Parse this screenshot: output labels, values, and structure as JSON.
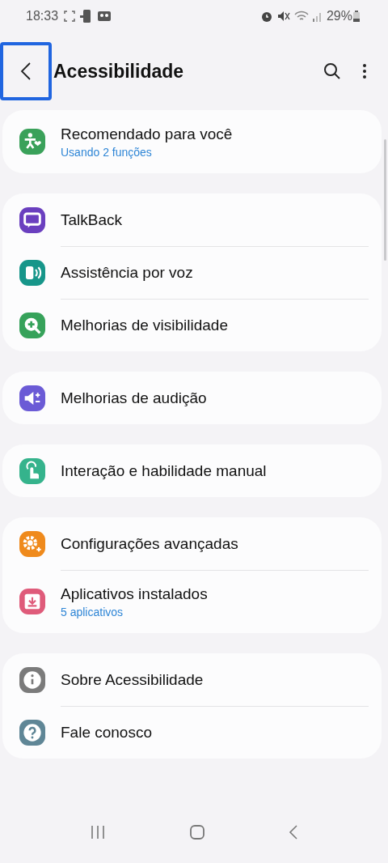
{
  "status_bar": {
    "time": "18:33",
    "battery": "29%"
  },
  "header": {
    "title": "Acessibilidade",
    "back_focused": true
  },
  "groups": [
    {
      "items": [
        {
          "title": "Recomendado para você",
          "subtitle": "Usando 2 funções",
          "color": "#3aa15a"
        }
      ]
    },
    {
      "items": [
        {
          "title": "TalkBack",
          "color": "#6a3fbf"
        },
        {
          "title": "Assistência por voz",
          "color": "#17968a"
        },
        {
          "title": "Melhorias de visibilidade",
          "color": "#36a25a"
        }
      ]
    },
    {
      "items": [
        {
          "title": "Melhorias de audição",
          "color": "#6b5bd6"
        }
      ]
    },
    {
      "items": [
        {
          "title": "Interação e habilidade manual",
          "color": "#35b38c"
        }
      ]
    },
    {
      "items": [
        {
          "title": "Configurações avançadas",
          "color": "#ef8a1c"
        },
        {
          "title": "Aplicativos instalados",
          "subtitle": "5 aplicativos",
          "color": "#df5b7a"
        }
      ]
    },
    {
      "items": [
        {
          "title": "Sobre Acessibilidade",
          "color": "#7b7b7b"
        },
        {
          "title": "Fale conosco",
          "color": "#5f8696"
        }
      ]
    }
  ]
}
